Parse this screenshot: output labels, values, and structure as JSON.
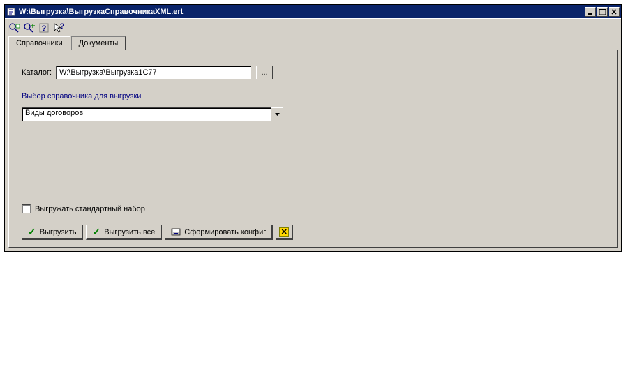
{
  "window": {
    "title": "W:\\Выгрузка\\ВыгрузкаСправочникаXML.ert"
  },
  "tabs": {
    "tab1": "Справочники",
    "tab2": "Документы"
  },
  "form": {
    "catalog_label": "Каталог:",
    "catalog_value": "W:\\Выгрузка\\Выгрузка1С77",
    "section_title": "Выбор справочника для выгрузки",
    "dropdown_value": "Виды договоров",
    "checkbox_label": "Выгружать стандартный набор"
  },
  "buttons": {
    "browse": "...",
    "export": "Выгрузить",
    "export_all": "Выгрузить все",
    "build_config": "Сформировать конфиг"
  }
}
